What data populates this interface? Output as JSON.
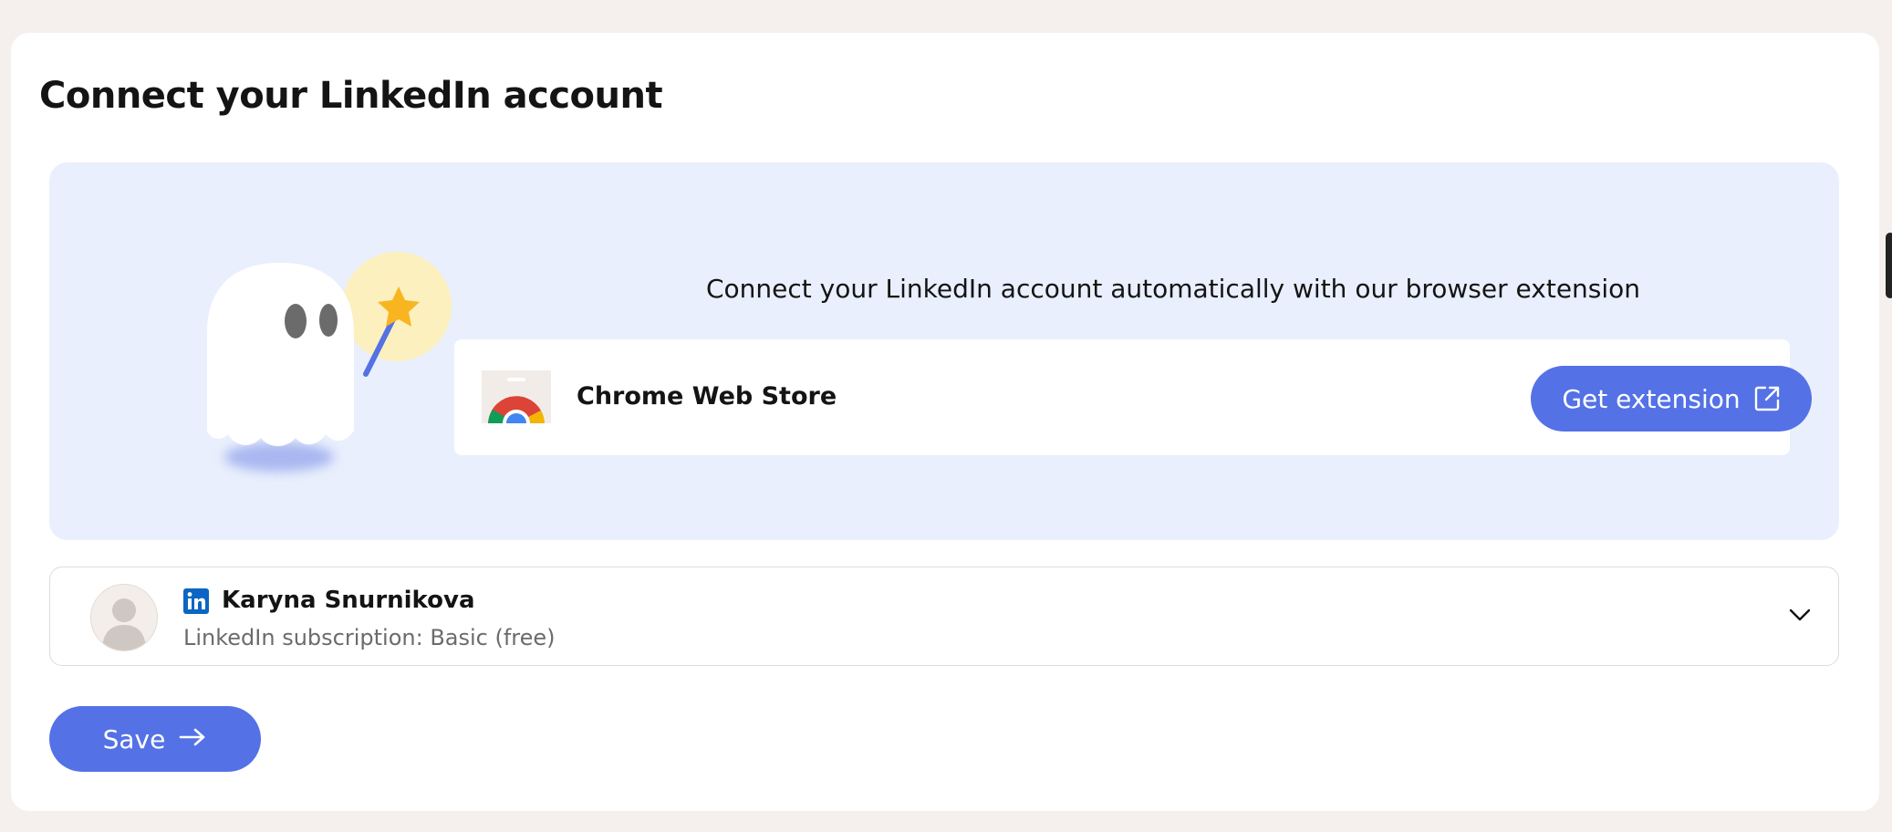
{
  "page": {
    "title": "Connect your LinkedIn account"
  },
  "promo": {
    "description": "Connect your LinkedIn account automatically with our browser extension",
    "illustration_icon": "ghost-with-magic-wand",
    "store": {
      "icon": "chrome-web-store-icon",
      "name": "Chrome Web Store",
      "button_label": "Get extension",
      "button_icon": "external-link-icon"
    }
  },
  "account": {
    "name": "Karyna Snurnikova",
    "network_icon": "linkedin-icon",
    "subscription": "LinkedIn subscription: Basic (free)",
    "expand_icon": "chevron-down-icon"
  },
  "footer": {
    "save_label": "Save",
    "save_icon": "arrow-right-icon"
  },
  "colors": {
    "accent": "#5471e6",
    "promo_background": "#e9effc",
    "page_background": "#f5f0ed",
    "linkedin": "#0a66c2"
  }
}
